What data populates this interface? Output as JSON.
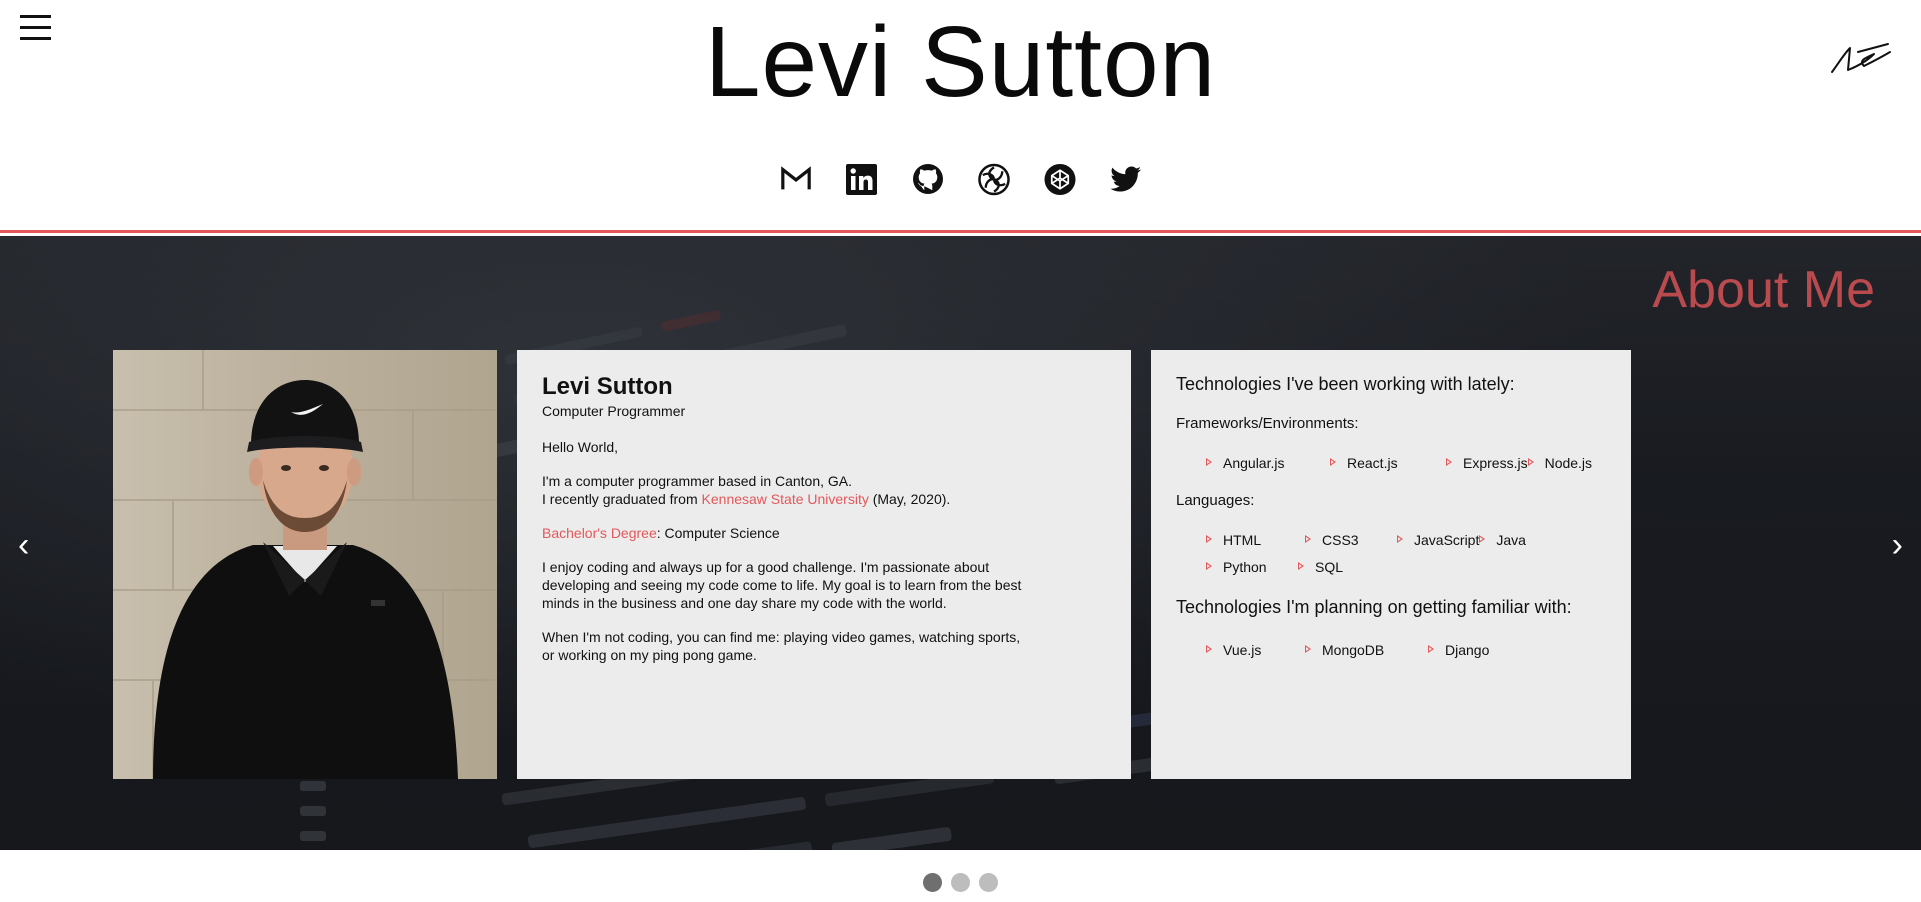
{
  "header": {
    "title": "Levi Sutton",
    "menu_icon": "hamburger-icon",
    "signature_icon": "signature-logo",
    "socials": [
      {
        "name": "gmail-icon"
      },
      {
        "name": "linkedin-icon"
      },
      {
        "name": "github-icon"
      },
      {
        "name": "codesandbox-icon"
      },
      {
        "name": "codepen-icon"
      },
      {
        "name": "twitter-icon"
      }
    ],
    "accent_color": "#e3585b"
  },
  "about": {
    "section_title": "About Me",
    "prev_arrow": "‹",
    "next_arrow": "›",
    "bio": {
      "name": "Levi Sutton",
      "role": "Computer Programmer",
      "greeting": "Hello World,",
      "location_line": "I'm a computer programmer based in Canton, GA.",
      "grad_prefix": "I recently graduated from ",
      "university": "Kennesaw State University",
      "grad_suffix": " (May, 2020).",
      "degree_link": "Bachelor's Degree",
      "degree_rest": ": Computer Science",
      "paragraph_coding": "I enjoy coding and always up for a good challenge. I'm passionate about developing and seeing my code come to life. My goal is to learn from the best minds in the business and one day share my code with the world.",
      "paragraph_hobbies": "When I'm not coding, you can find me: playing video games, watching sports, or working on my ping pong game."
    },
    "tech": {
      "heading_current": "Technologies I've been working with lately:",
      "frameworks_label": "Frameworks/Environments:",
      "frameworks": [
        "Angular.js",
        "React.js",
        "Express.js",
        "Node.js"
      ],
      "languages_label": "Languages:",
      "languages": [
        "HTML",
        "CSS3",
        "JavaScript",
        "Java",
        "Python",
        "SQL"
      ],
      "heading_planned": "Technologies I'm planning on getting familiar with:",
      "planned": [
        "Vue.js",
        "MongoDB",
        "Django"
      ]
    }
  },
  "carousel": {
    "slides": 3,
    "active_index": 0
  }
}
